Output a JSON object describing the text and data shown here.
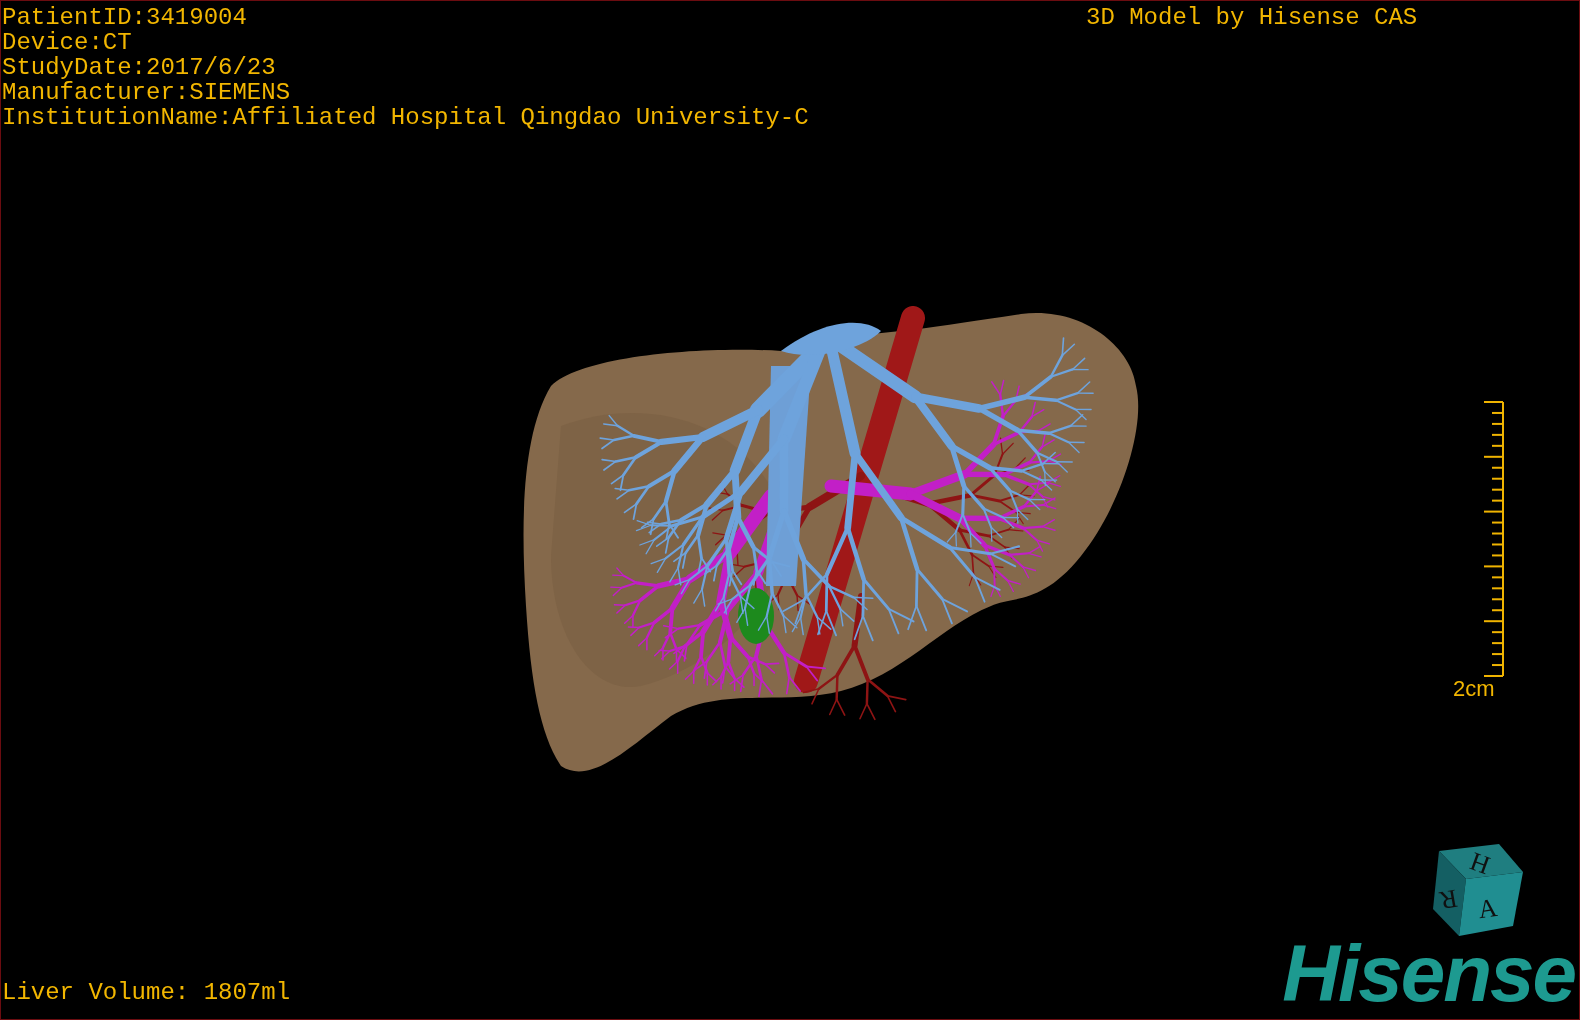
{
  "patient_info": [
    "PatientID:3419004",
    "Device:CT",
    "StudyDate:2017/6/23",
    "Manufacturer:SIEMENS",
    "InstitutionName:Affiliated Hospital Qingdao University-C"
  ],
  "title": "3D Model by Hisense CAS",
  "scale_bar": {
    "label": "2cm"
  },
  "orientation_cube": {
    "faces": [
      "H",
      "R",
      "A"
    ]
  },
  "liver_volume": "Liver Volume: 1807ml",
  "logo": "Hisense"
}
